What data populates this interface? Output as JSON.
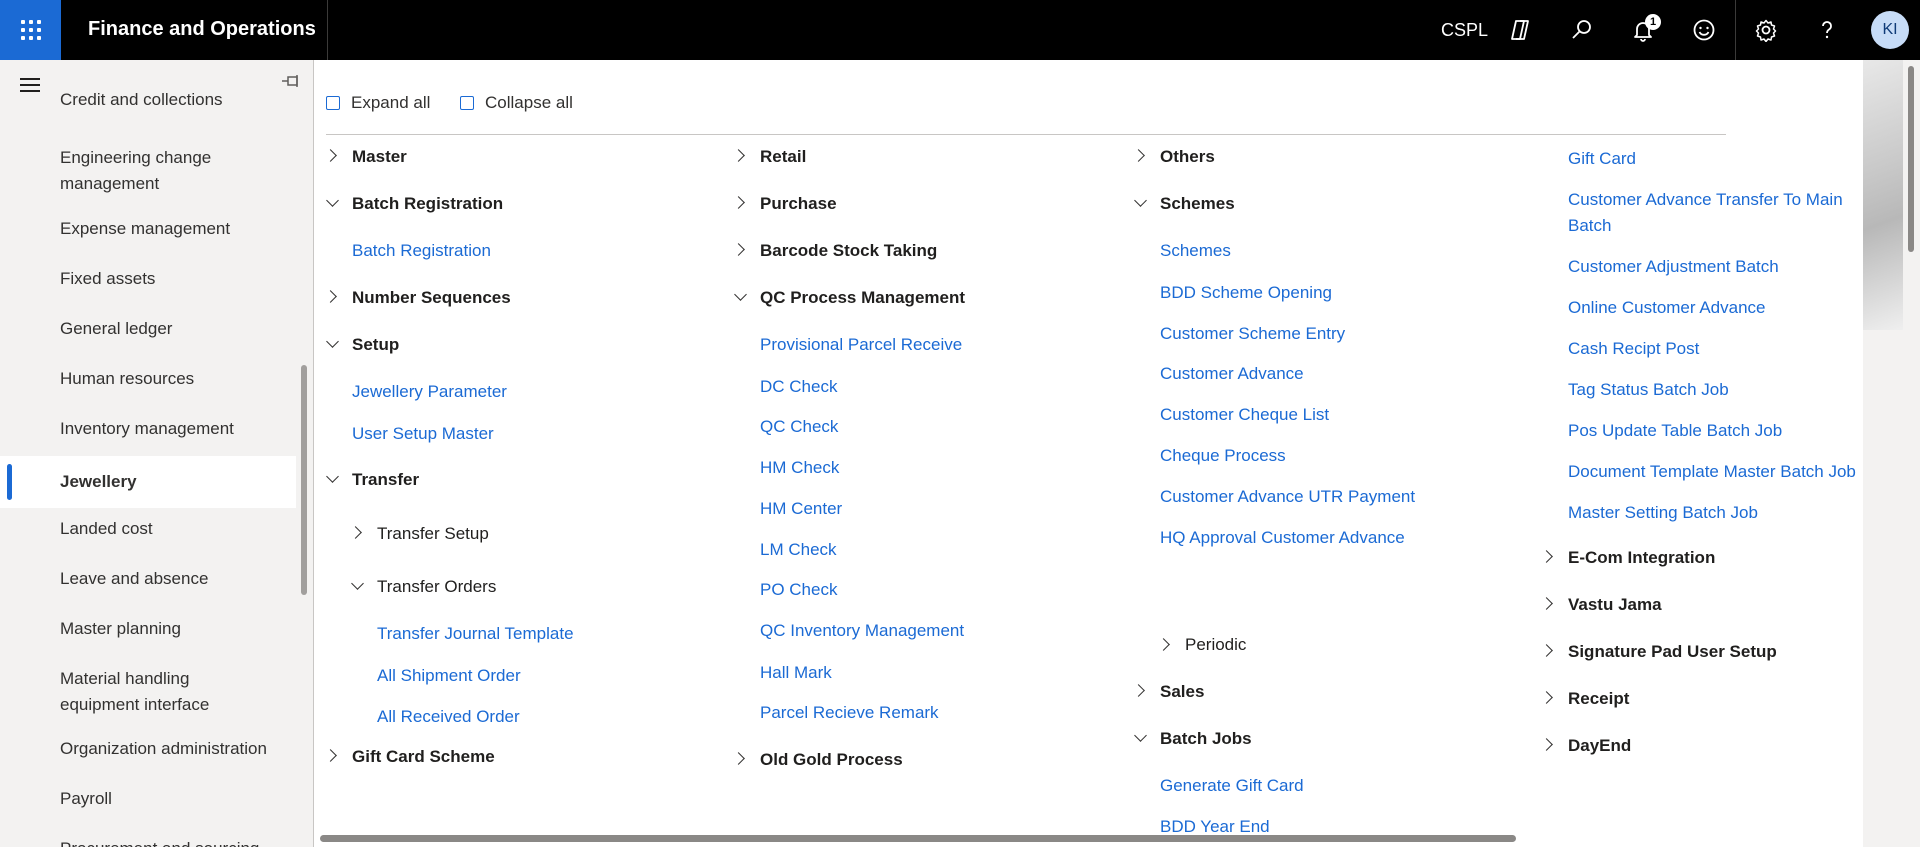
{
  "header": {
    "app_title": "Finance and Operations",
    "company": "CSPL",
    "notification_count": "1",
    "avatar_initials": "KI"
  },
  "sidebar": {
    "items": [
      "Credit and collections",
      "Engineering change management",
      "Expense management",
      "Fixed assets",
      "General ledger",
      "Human resources",
      "Inventory management",
      "Jewellery",
      "Landed cost",
      "Leave and absence",
      "Master planning",
      "Material handling equipment interface",
      "Organization administration",
      "Payroll",
      "Procurement and sourcing"
    ],
    "active": "Jewellery"
  },
  "toolbar": {
    "expand_all": "Expand all",
    "collapse_all": "Collapse all"
  },
  "menu": {
    "col1": {
      "master": "Master",
      "batch_registration_group": "Batch Registration",
      "batch_registration": "Batch Registration",
      "number_sequences": "Number Sequences",
      "setup": "Setup",
      "jewellery_parameter": "Jewellery Parameter",
      "user_setup_master": "User Setup Master",
      "transfer": "Transfer",
      "transfer_setup": "Transfer Setup",
      "transfer_orders": "Transfer Orders",
      "transfer_journal_template": "Transfer Journal Template",
      "all_shipment_order": "All Shipment Order",
      "all_received_order": "All Received Order",
      "gift_card_scheme": "Gift Card Scheme"
    },
    "col2": {
      "retail": "Retail",
      "purchase": "Purchase",
      "barcode_stock_taking": "Barcode Stock Taking",
      "qc_process_management": "QC Process Management",
      "provisional_parcel_receive": "Provisional Parcel Receive",
      "dc_check": "DC Check",
      "qc_check": "QC Check",
      "hm_check": "HM Check",
      "hm_center": "HM Center",
      "lm_check": "LM Check",
      "po_check": "PO Check",
      "qc_inventory_management": "QC Inventory Management",
      "hall_mark": "Hall Mark",
      "parcel_recieve_remark": "Parcel Recieve Remark",
      "old_gold_process": "Old Gold Process"
    },
    "col3": {
      "others": "Others",
      "schemes_group": "Schemes",
      "schemes": "Schemes",
      "bdd_scheme_opening": "BDD Scheme Opening",
      "customer_scheme_entry": "Customer Scheme Entry",
      "customer_advance": "Customer Advance",
      "customer_cheque_list": "Customer Cheque List",
      "cheque_process": "Cheque Process",
      "customer_advance_utr_payment": "Customer Advance UTR Payment",
      "hq_approval_customer_advance": "HQ Approval Customer Advance",
      "periodic": "Periodic",
      "sales": "Sales",
      "batch_jobs": "Batch Jobs",
      "generate_gift_card": "Generate Gift Card",
      "bdd_year_end": "BDD Year End"
    },
    "col4": {
      "gift_card": "Gift Card",
      "customer_advance_transfer_1": "Customer Advance Transfer To Main",
      "customer_advance_transfer_2": "Batch",
      "customer_adjustment_batch": "Customer Adjustment Batch",
      "online_customer_advance": "Online Customer Advance",
      "cash_recipt_post": "Cash Recipt Post",
      "tag_status_batch_job": "Tag Status Batch Job",
      "pos_update_table_batch_job": "Pos Update Table Batch Job",
      "document_template_master_batch_job": "Document Template Master Batch Job",
      "master_setting_batch_job": "Master Setting Batch Job",
      "ecom_integration": "E-Com Integration",
      "vastu_jama": "Vastu Jama",
      "signature_pad_user_setup": "Signature Pad User Setup",
      "receipt": "Receipt",
      "dayend": "DayEnd"
    }
  }
}
